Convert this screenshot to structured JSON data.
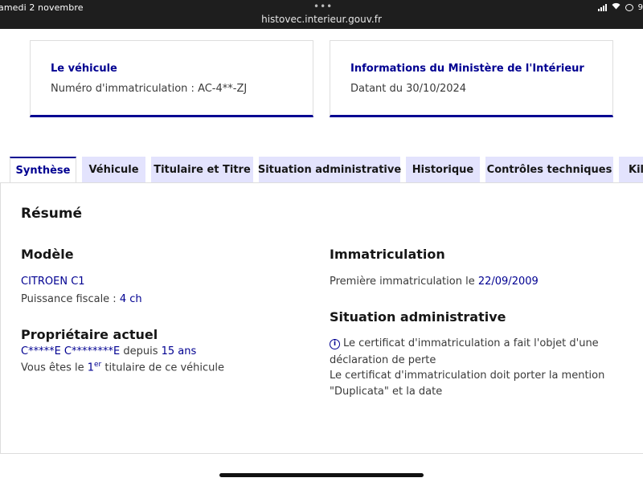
{
  "status_bar": {
    "date": "amedi 2 novembre",
    "dots": "•••",
    "url": "histovec.interieur.gouv.fr",
    "battery_text": "9"
  },
  "cards": {
    "vehicle": {
      "title": "Le véhicule",
      "text": "Numéro d'immatriculation : AC-4**-ZJ"
    },
    "ministry": {
      "title": "Informations du Ministère de l'Intérieur",
      "text": "Datant du 30/10/2024"
    }
  },
  "tabs": [
    {
      "label": "Synthèse",
      "active": true
    },
    {
      "label": "Véhicule"
    },
    {
      "label": "Titulaire et Titre"
    },
    {
      "label": "Situation administrative"
    },
    {
      "label": "Historique"
    },
    {
      "label": "Contrôles techniques"
    },
    {
      "label": "Kilo"
    }
  ],
  "summary": {
    "title": "Résumé",
    "model": {
      "heading": "Modèle",
      "name": "CITROEN C1",
      "power_label": "Puissance fiscale : ",
      "power_value": "4 ch"
    },
    "owner": {
      "heading": "Propriétaire actuel",
      "name": "C*****E C********E",
      "since_label": " depuis ",
      "since_value": "15 ans",
      "rank_prefix": "Vous êtes le ",
      "rank_num": "1",
      "rank_sup": "er",
      "rank_suffix": " titulaire de ce véhicule"
    },
    "registration": {
      "heading": "Immatriculation",
      "first_label": "Première immatriculation le ",
      "first_date": "22/09/2009"
    },
    "admin": {
      "heading": "Situation administrative",
      "icon": "info-icon",
      "line1": "Le certificat d'immatriculation a fait l'objet d'une",
      "line2": "déclaration de perte",
      "line3": "Le certificat d'immatriculation doit porter la mention",
      "line4": "\"Duplicata\" et la date"
    }
  },
  "colors": {
    "accent": "#000091",
    "tab_bg": "#e3e3fd",
    "text": "#161616",
    "muted": "#3a3a3a"
  }
}
